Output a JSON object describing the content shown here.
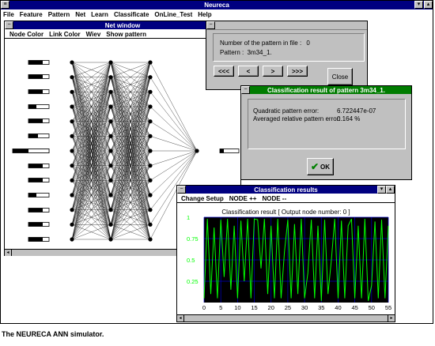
{
  "app": {
    "title": "Neureca",
    "menu": [
      "File",
      "Feature",
      "Pattern",
      "Net",
      "Learn",
      "Classificate",
      "OnLine_Test",
      "Help"
    ]
  },
  "net_window": {
    "title": "Net window",
    "menu": [
      "Node Color",
      "Link Color",
      "Wiev",
      "Show pattern"
    ]
  },
  "pattern_dialog": {
    "count_label": "Number of the pattern in file :",
    "count_value": "0",
    "pattern_label": "Pattern :",
    "pattern_value": "3m34_1.",
    "nav_first": "<<<",
    "nav_prev": "<",
    "nav_next": ">",
    "nav_last": ">>>",
    "close": "Close"
  },
  "result_dialog": {
    "title": "Classification result of pattern 3m34_1.",
    "quad_label": "Quadratic pattern error:",
    "quad_value": "6.722447e-07",
    "avg_label": "Averaged relative pattern error:",
    "avg_value": "0.164 %",
    "ok": "OK"
  },
  "results_window": {
    "title": "Classification results",
    "menu": [
      "Change Setup",
      "NODE ++",
      "NODE --"
    ],
    "chart_title": "Classification result [ Output node number: 0 ]"
  },
  "caption": "The NEURECA ANN simulator.",
  "colors": {
    "titlebar": "#000080",
    "titlebar_result": "#007c00",
    "window": "#c0c0c0",
    "plot_bg": "#000000",
    "plot_line": "#00ff00",
    "plot_grid": "#0000c0"
  },
  "chart_data": {
    "type": "line",
    "title": "Classification result [ Output node number: 0 ]",
    "xlim": [
      0,
      55
    ],
    "ylim": [
      0,
      1
    ],
    "x_ticks": [
      0,
      5,
      10,
      15,
      20,
      25,
      30,
      35,
      40,
      45,
      50,
      55
    ],
    "y_ticks": [
      0.25,
      0.5,
      0.75,
      1
    ],
    "series": [
      {
        "values": [
          0.05,
          0.98,
          0.1,
          0.88,
          0.05,
          0.97,
          0.3,
          0.98,
          0.15,
          0.9,
          0.05,
          0.96,
          0.25,
          0.98,
          0.05,
          0.98,
          0.97,
          0.4,
          0.98,
          0.1,
          0.9,
          0.05,
          0.98,
          0.05,
          0.6,
          0.97,
          0.05,
          0.92,
          0.1,
          0.98,
          0.05,
          0.35,
          0.97,
          0.05,
          0.9,
          0.02,
          0.97,
          0.1,
          0.5,
          0.98,
          0.05,
          0.96,
          0.05,
          0.9,
          0.98,
          0.05,
          0.9,
          0.05,
          0.98,
          0.02,
          0.2,
          0.95,
          0.05,
          0.97,
          0.05,
          0.9
        ]
      }
    ]
  }
}
